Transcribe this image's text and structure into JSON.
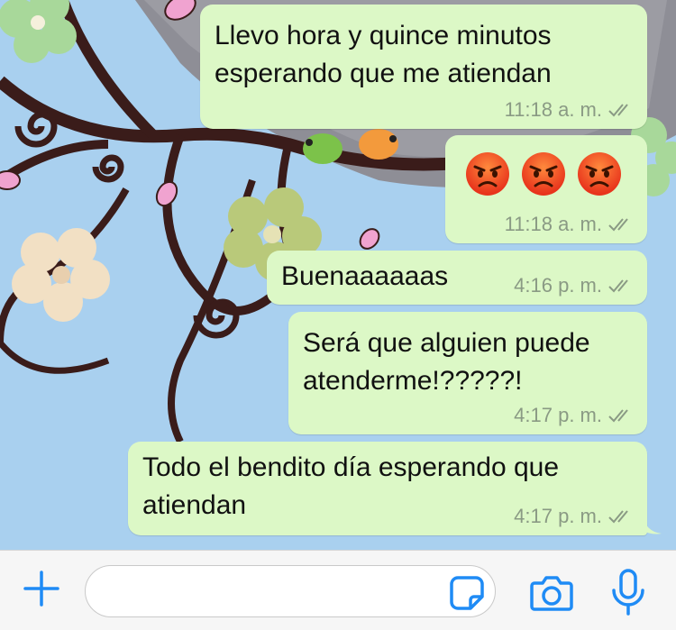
{
  "colors": {
    "accent": "#1f8bf5",
    "bubble": "#dcf8c6",
    "meta": "#8a9a84"
  },
  "messages": [
    {
      "text": "Llevo hora y quince minutos esperando que me atiendan",
      "time": "11:18 a. m.",
      "status": "double-check"
    },
    {
      "emojis": [
        "angry-face",
        "angry-face",
        "angry-face"
      ],
      "time": "11:18 a. m.",
      "status": "double-check"
    },
    {
      "text": "Buenaaaaaas",
      "time": "4:16 p. m.",
      "status": "double-check"
    },
    {
      "text": "Será que alguien puede atenderme!?????!",
      "time": "4:17 p. m.",
      "status": "double-check"
    },
    {
      "text": "Todo el bendito día esperando que atiendan",
      "time": "4:17 p. m.",
      "status": "double-check"
    }
  ],
  "input_bar": {
    "icons": [
      "plus-icon",
      "sticker-icon",
      "camera-icon",
      "microphone-icon"
    ],
    "value": ""
  }
}
